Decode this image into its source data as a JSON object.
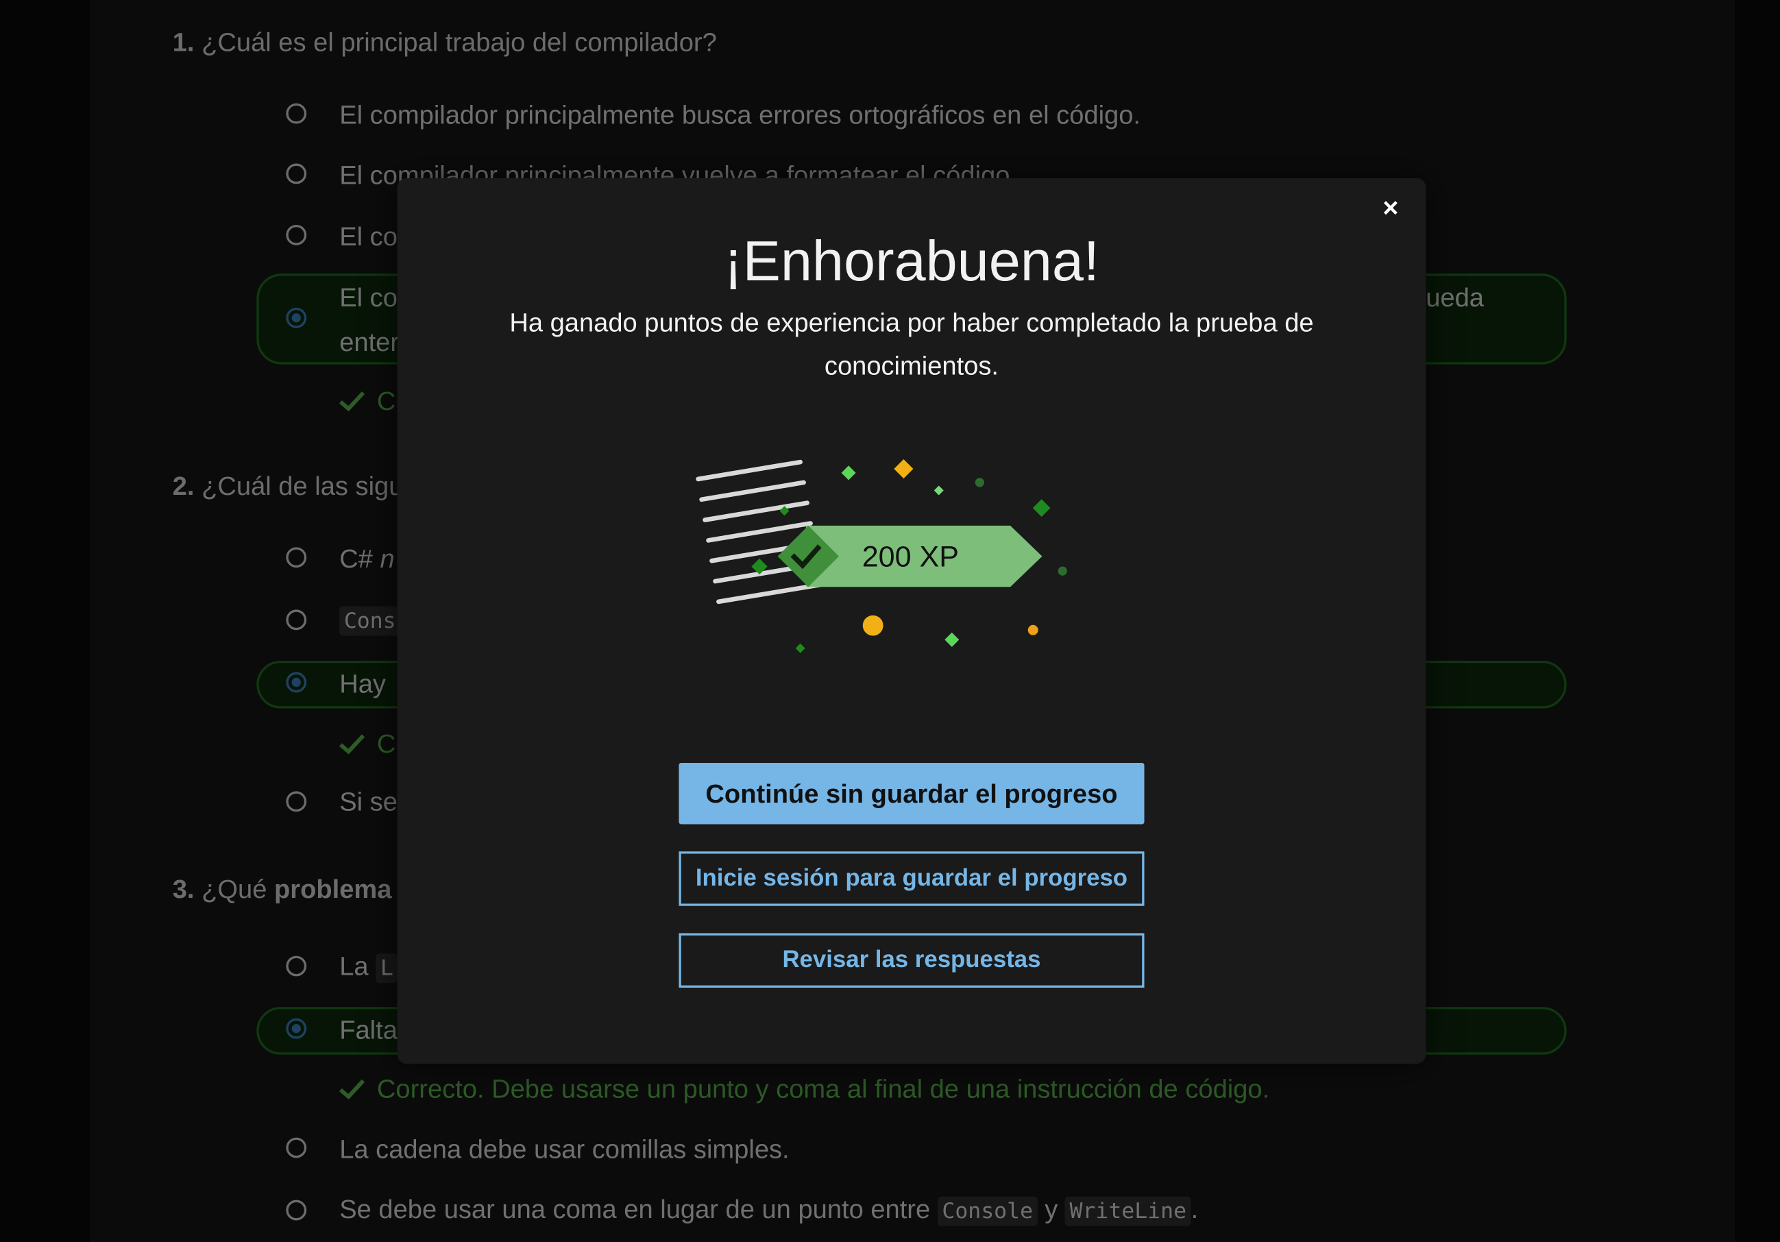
{
  "quiz": {
    "q1": {
      "number": "1.",
      "title": "¿Cuál es el principal trabajo del compilador?",
      "options": [
        "El compilador principalmente busca errores ortográficos en el código.",
        "El compilador principalmente vuelve a formatear el código.",
        "El co",
        "El co",
        "enter"
      ],
      "selected_tail": "ueda",
      "feedback": "C"
    },
    "q2": {
      "number": "2.",
      "title": "¿Cuál de las sigu",
      "options": [
        "C#",
        "n",
        "Cons",
        "Hay",
        "Si se"
      ],
      "feedback": "C"
    },
    "q3": {
      "number": "3.",
      "title_start": "¿Qué",
      "title_bold": "problema",
      "options": [
        "La",
        "L",
        "Falta",
        "La cadena debe usar comillas simples.",
        "Se debe usar una coma en lugar de un punto entre",
        "Console",
        "y",
        "WriteLine",
        "."
      ],
      "feedback": "Correcto. Debe usarse un punto y coma al final de una instrucción de código."
    }
  },
  "modal": {
    "close_label": "×",
    "title": "¡Enhorabuena!",
    "body": "Ha ganado puntos de experiencia por haber completado la prueba de conocimientos.",
    "xp_label": "200 XP",
    "buttons": {
      "continue": "Continúe sin guardar el progreso",
      "signin": "Inicie sesión para guardar el progreso",
      "review": "Revisar las respuestas"
    }
  },
  "colors": {
    "accent": "#75b6e7",
    "success": "#57b04a",
    "selected_bg": "#0f2a0f",
    "badge_green": "#7dbf7a",
    "modal_bg": "#1a1a1a"
  }
}
